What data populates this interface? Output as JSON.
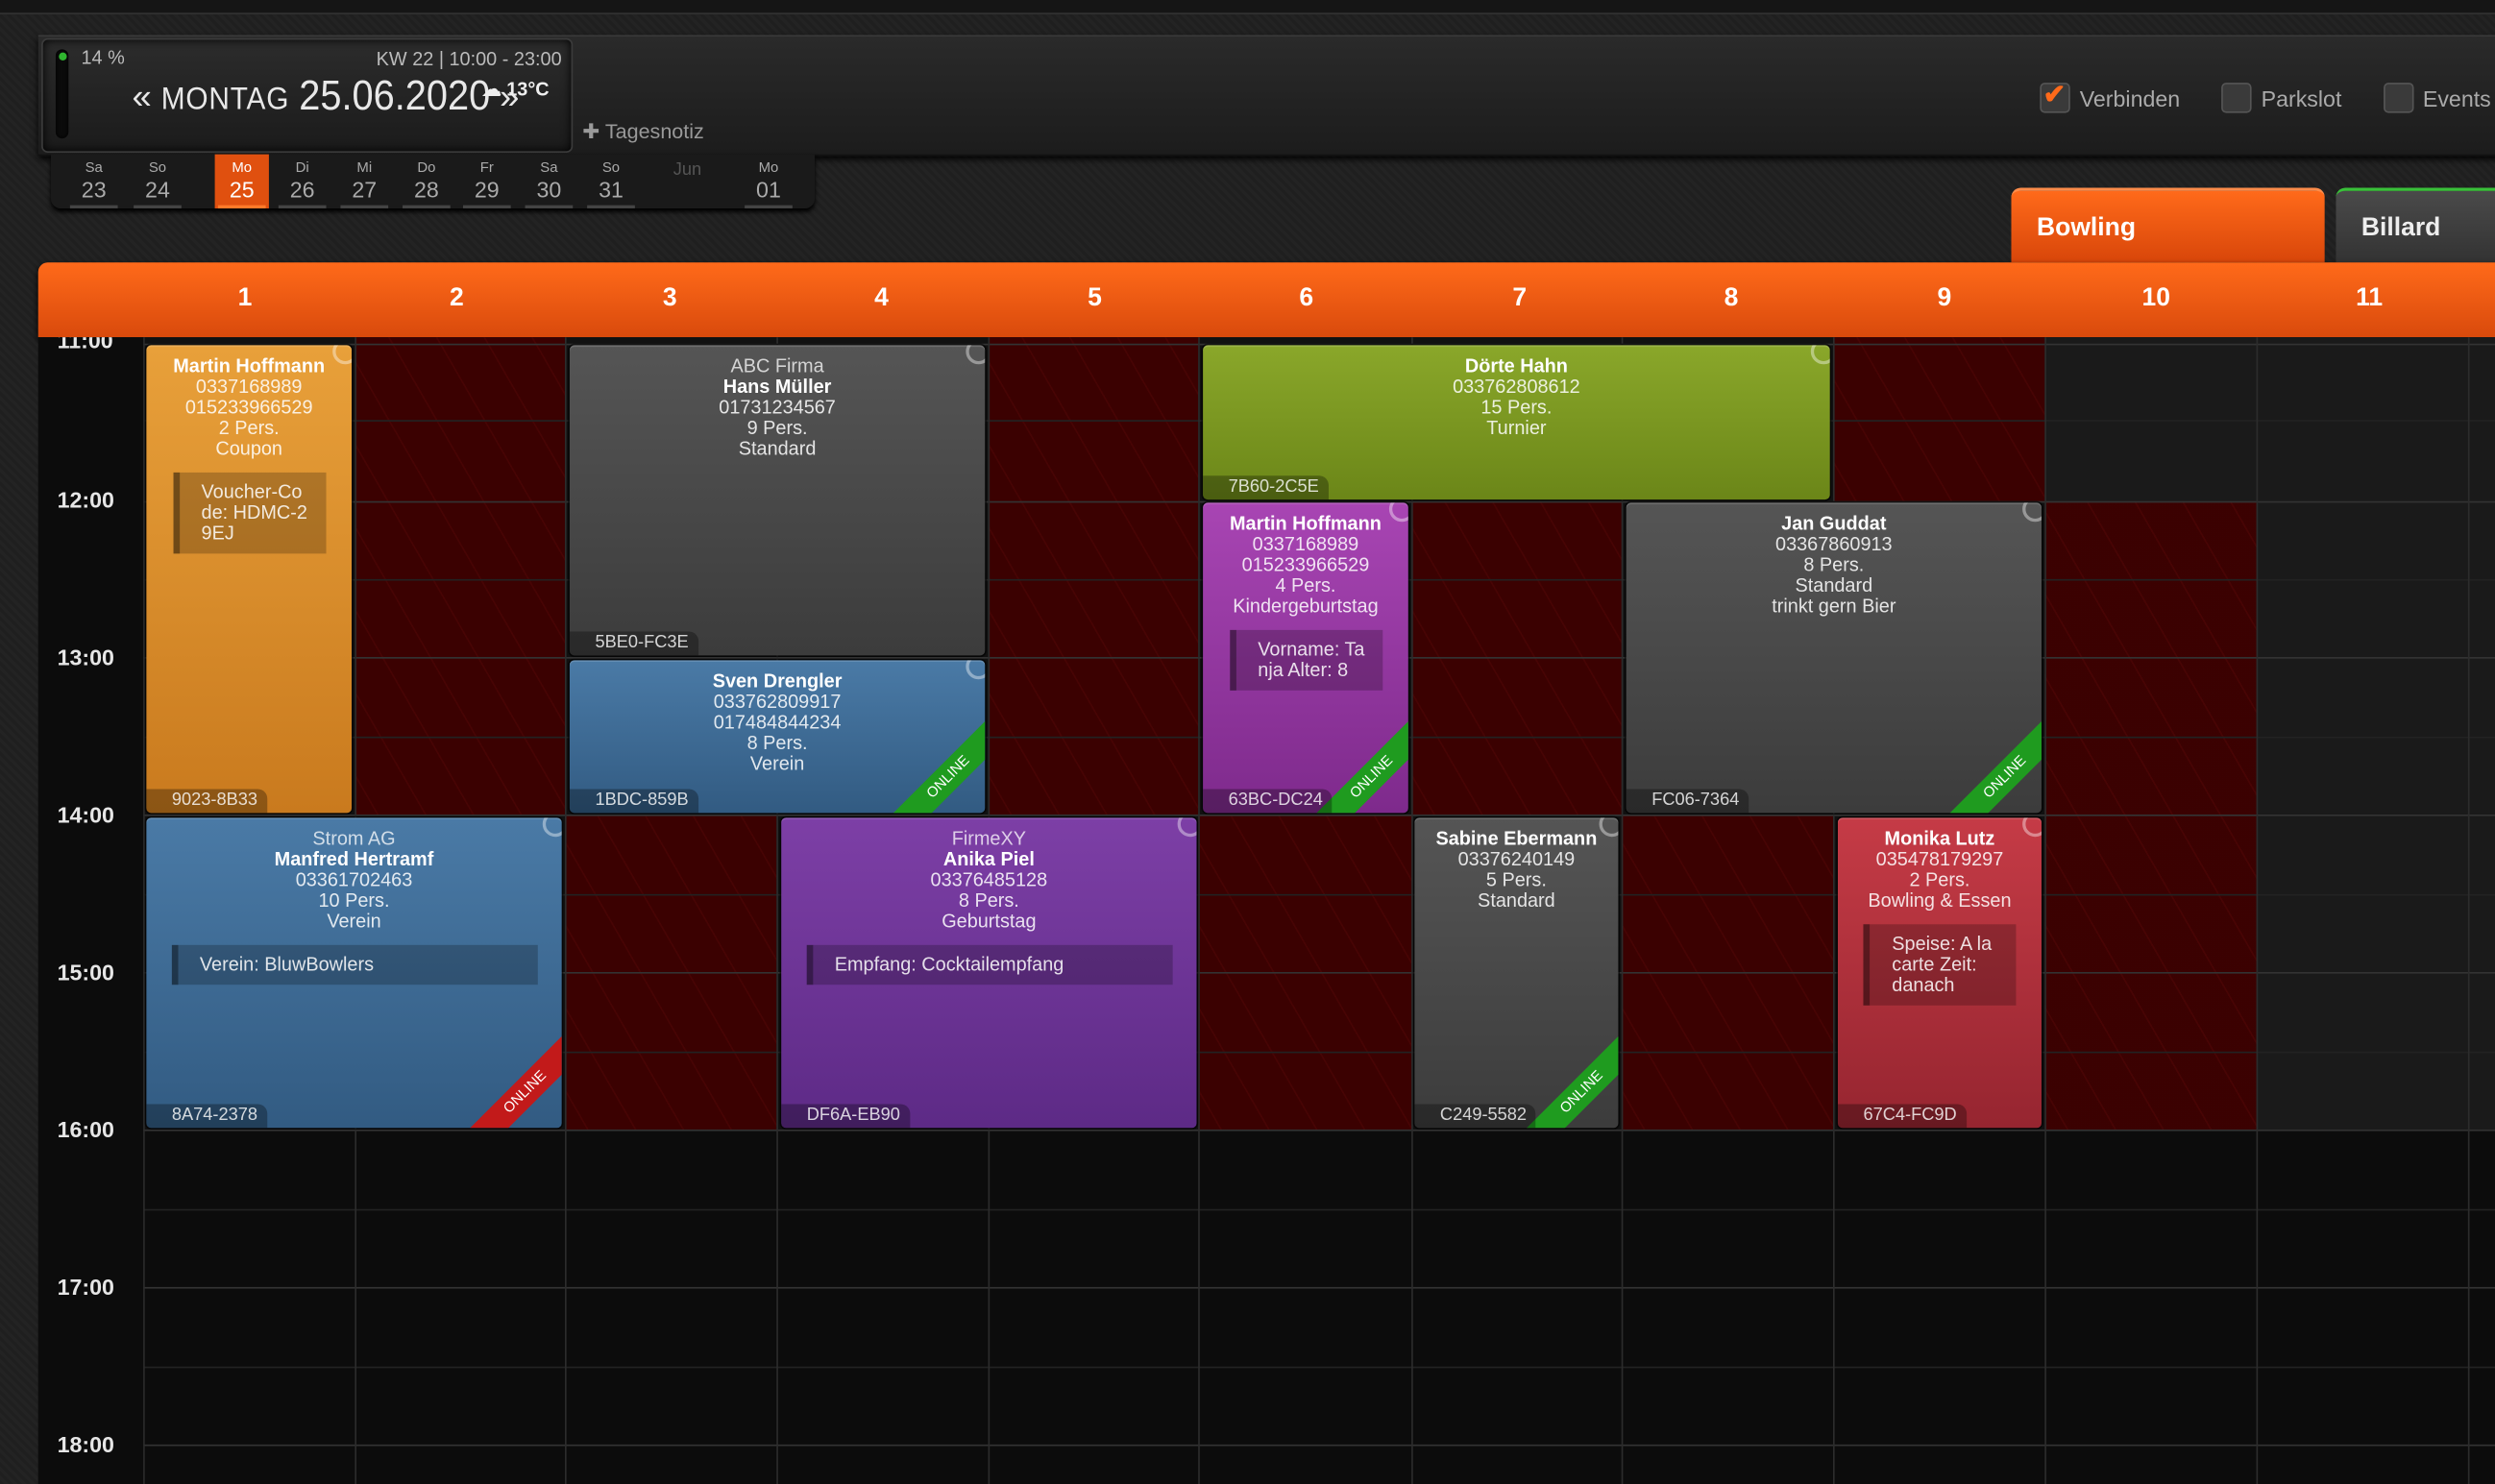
{
  "header": {
    "percent": "14 %",
    "kw": "KW 22 | 10:00 - 23:00",
    "prev": "«",
    "next": "»",
    "dayname": "MONTAG",
    "date": "25.06.2020",
    "weather": "13°C",
    "notiz_label": "Tagesnotiz"
  },
  "days": [
    {
      "n": "Sa",
      "d": "23"
    },
    {
      "n": "So",
      "d": "24"
    },
    {
      "n": "Mo",
      "d": "25"
    },
    {
      "n": "Di",
      "d": "26"
    },
    {
      "n": "Mi",
      "d": "27"
    },
    {
      "n": "Do",
      "d": "28"
    },
    {
      "n": "Fr",
      "d": "29"
    },
    {
      "n": "Sa",
      "d": "30"
    },
    {
      "n": "So",
      "d": "31"
    },
    {
      "n": "",
      "d": "Jun"
    },
    {
      "n": "Mo",
      "d": "01"
    }
  ],
  "toggles": [
    {
      "label": "Verbinden",
      "checked": true
    },
    {
      "label": "Parkslot",
      "checked": false
    },
    {
      "label": "Events",
      "checked": false
    }
  ],
  "tabs": {
    "bowling": "Bowling",
    "billard": "Billard"
  },
  "lanes": [
    "1",
    "2",
    "3",
    "4",
    "5",
    "6",
    "7",
    "8",
    "9",
    "10",
    "11"
  ],
  "times": [
    "11:00",
    "12:00",
    "13:00",
    "14:00",
    "15:00",
    "16:00",
    "17:00",
    "18:00"
  ],
  "online_label": "ONLINE",
  "bookings": {
    "b1": {
      "pre": "",
      "name": "Martin Hoffmann",
      "lines": [
        "0337168989",
        "015233966529",
        "2 Pers.",
        "Coupon"
      ],
      "note": "Voucher-Co de: HDMC-2 9EJ",
      "code": "9023-8B33"
    },
    "b2": {
      "pre": "ABC Firma",
      "name": "Hans Müller",
      "lines": [
        "01731234567",
        "9 Pers.",
        "Standard"
      ],
      "code": "5BE0-FC3E"
    },
    "b3": {
      "pre": "",
      "name": "Dörte Hahn",
      "lines": [
        "033762808612",
        "15 Pers.",
        "Turnier"
      ],
      "code": "7B60-2C5E"
    },
    "b4": {
      "pre": "",
      "name": "Sven Drengler",
      "lines": [
        "033762809917",
        "017484844234",
        "8 Pers.",
        "Verein"
      ],
      "code": "1BDC-859B"
    },
    "b5": {
      "pre": "",
      "name": "Martin Hoffmann",
      "lines": [
        "0337168989",
        "015233966529",
        "4 Pers.",
        "Kindergeburtstag"
      ],
      "note": "Vorname: Ta nja Alter: 8",
      "code": "63BC-DC24"
    },
    "b6": {
      "pre": "",
      "name": "Jan Guddat",
      "lines": [
        "03367860913",
        "8 Pers.",
        "Standard",
        "trinkt gern Bier"
      ],
      "code": "FC06-7364"
    },
    "b7": {
      "pre": "Strom AG",
      "name": "Manfred Hertramf",
      "lines": [
        "03361702463",
        "10 Pers.",
        "Verein"
      ],
      "note": "Verein: BluwBowlers",
      "code": "8A74-2378"
    },
    "b8": {
      "pre": "FirmeXY",
      "name": "Anika Piel",
      "lines": [
        "03376485128",
        "8 Pers.",
        "Geburtstag"
      ],
      "note": "Empfang: Cocktailempfang",
      "code": "DF6A-EB90"
    },
    "b9": {
      "pre": "",
      "name": "Sabine Ebermann",
      "lines": [
        "03376240149",
        "5 Pers.",
        "Standard"
      ],
      "code": "C249-5582"
    },
    "b10": {
      "pre": "",
      "name": "Monika Lutz",
      "lines": [
        "035478179297",
        "2 Pers.",
        "Bowling & Essen"
      ],
      "note": "Speise: A la carte Zeit: danach",
      "code": "67C4-FC9D"
    }
  },
  "colors": {
    "accent": "#e0500f",
    "blocked": "#3d0000",
    "online_green": "#1f9b1f",
    "online_red": "#c21a1a"
  }
}
